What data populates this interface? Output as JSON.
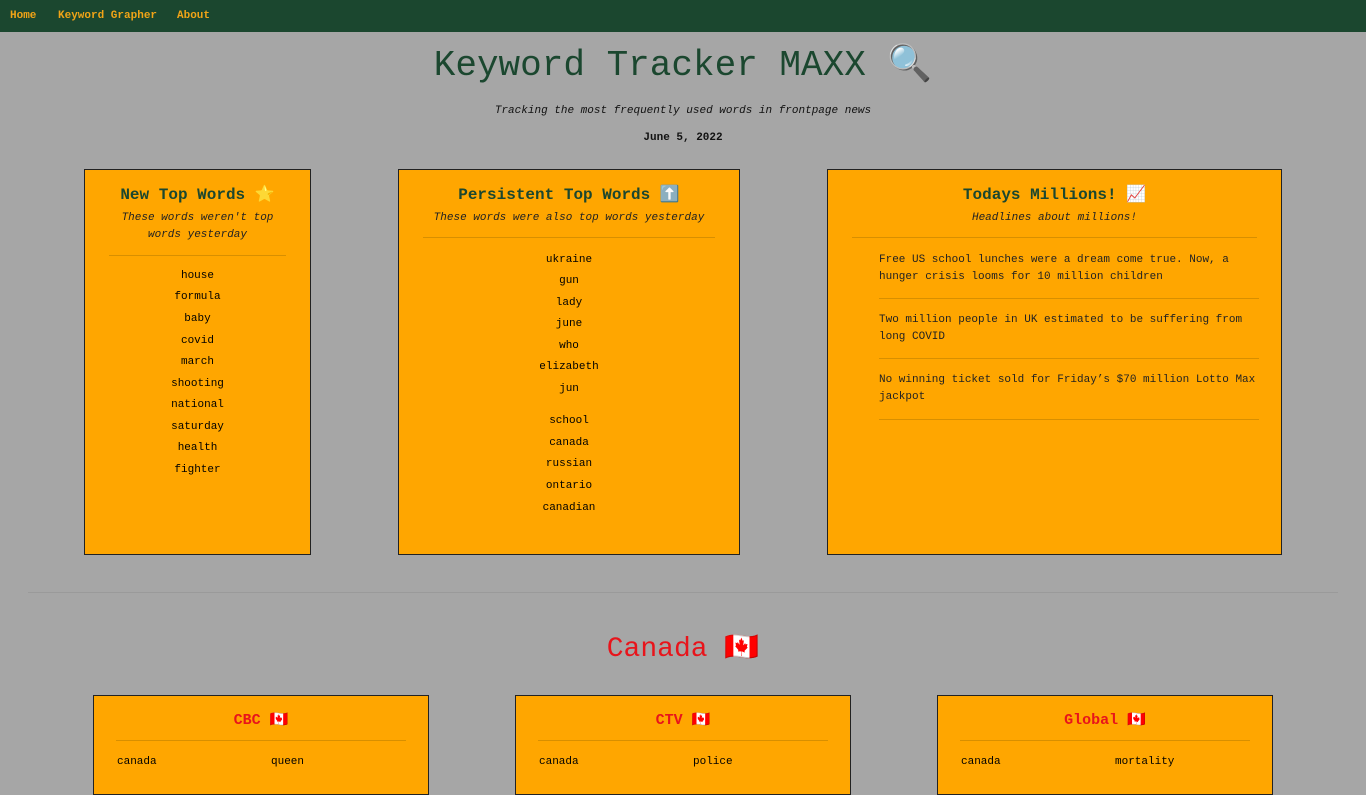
{
  "nav": {
    "home": "Home",
    "grapher": "Keyword Grapher",
    "about": "About"
  },
  "header": {
    "title": "Keyword Tracker MAXX 🔍",
    "subtitle": "Tracking the most frequently used words in frontpage news",
    "date": "June 5, 2022"
  },
  "new_top_words": {
    "title": "New Top Words ⭐",
    "subtitle": "These words weren't top words yesterday",
    "words": [
      "house",
      "formula",
      "baby",
      "covid",
      "march",
      "shooting",
      "national",
      "saturday",
      "health",
      "fighter"
    ]
  },
  "persistent_top_words": {
    "title": "Persistent Top Words ⬆️",
    "subtitle": "These words were also top words yesterday",
    "words": [
      "ukraine",
      "gun",
      "lady",
      "june",
      "who",
      "elizabeth",
      "jun",
      "school",
      "canada",
      "russian",
      "ontario",
      "canadian"
    ]
  },
  "millions": {
    "title": "Todays Millions! 📈",
    "subtitle": "Headlines about millions!",
    "headlines": [
      "Free US school lunches were a dream come true. Now, a hunger crisis looms for 10 million children",
      "Two million people in UK estimated to be suffering from long COVID",
      "No winning ticket sold for Friday’s $70 million Lotto Max jackpot"
    ]
  },
  "country": {
    "title": "Canada 🇨🇦",
    "sources": [
      {
        "title": "CBC 🇨🇦",
        "word1": "canada",
        "word2": "queen"
      },
      {
        "title": "CTV 🇨🇦",
        "word1": "canada",
        "word2": "police"
      },
      {
        "title": "Global 🇨🇦",
        "word1": "canada",
        "word2": "mortality"
      }
    ]
  },
  "colors": {
    "nav_bg": "#1b472f",
    "nav_link": "#f1a417",
    "page_bg": "#a6a6a6",
    "card_bg": "#ffa600",
    "title_green": "#1b472f",
    "country_red": "#e8141b"
  }
}
